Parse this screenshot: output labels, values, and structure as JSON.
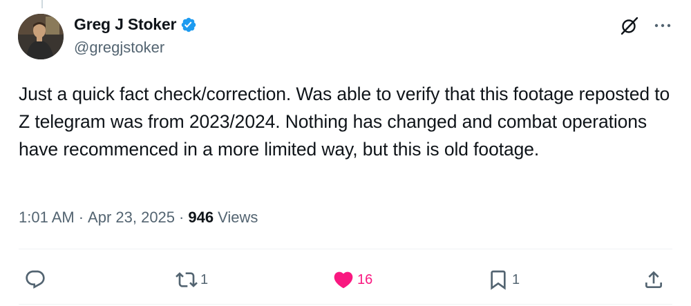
{
  "author": {
    "display_name": "Greg J Stoker",
    "handle": "@gregjstoker",
    "verified": true
  },
  "tweet": {
    "text": "Just a quick fact check/correction. Was able to verify that this footage reposted to Z telegram was from 2023/2024. Nothing has changed and combat operations have recommenced in a more limited way, but this is old footage."
  },
  "meta": {
    "time": "1:01 AM",
    "separator": "·",
    "date": "Apr 23, 2025",
    "views_count": "946",
    "views_label": "Views"
  },
  "actions": {
    "replies": "",
    "reposts": "1",
    "likes": "16",
    "bookmarks": "1"
  },
  "icons": {
    "verified": "verified-badge-icon",
    "grok": "grok-icon",
    "more": "more-icon",
    "reply": "reply-icon",
    "repost": "repost-icon",
    "like": "heart-icon",
    "bookmark": "bookmark-icon",
    "share": "share-icon"
  },
  "colors": {
    "verified_blue": "#1d9bf0",
    "like_pink": "#f91880",
    "secondary_text": "#536471",
    "primary_text": "#0f1419"
  }
}
